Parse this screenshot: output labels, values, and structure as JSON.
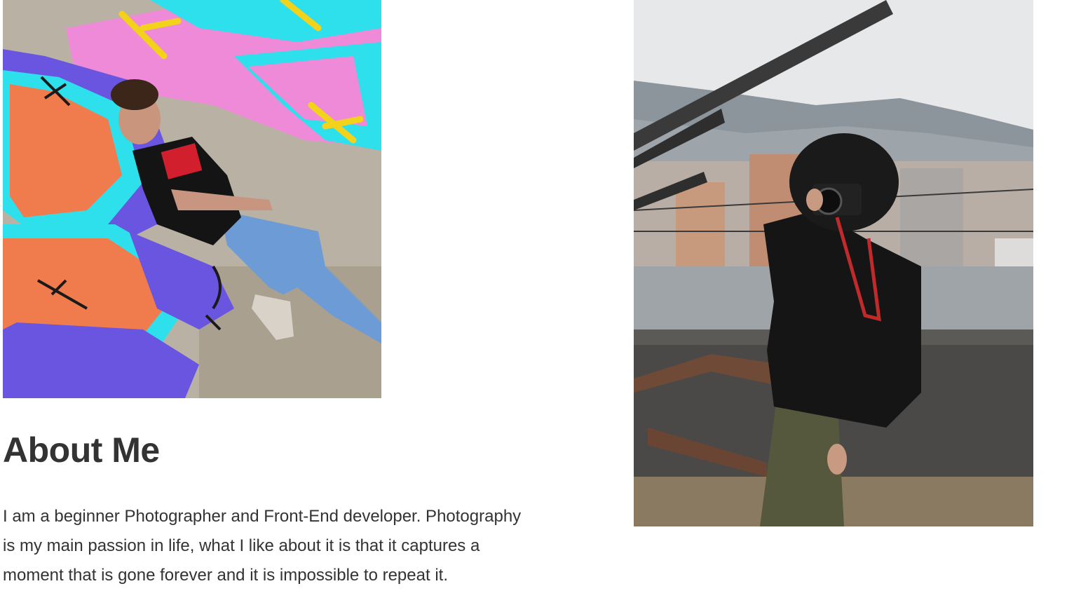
{
  "about": {
    "title": "About Me",
    "description": "I am a beginner Photographer and Front-End developer. Photography is my main passion in life, what I like about it is that it captures a moment that is gone forever and it is impossible to repeat it."
  },
  "photos": [
    {
      "name": "graffiti-portrait",
      "subject": "young man reclining on colorful graffiti wall"
    },
    {
      "name": "photographer-rooftop",
      "subject": "hooded photographer holding camera on rooftop"
    }
  ],
  "colors": {
    "text": "#333333",
    "background": "#ffffff",
    "graffiti_pink": "#ee8ad8",
    "graffiti_cyan": "#2ee0ec",
    "graffiti_orange": "#f07c4e",
    "graffiti_purple": "#6a55e0",
    "sky": "#e6e8ea"
  }
}
